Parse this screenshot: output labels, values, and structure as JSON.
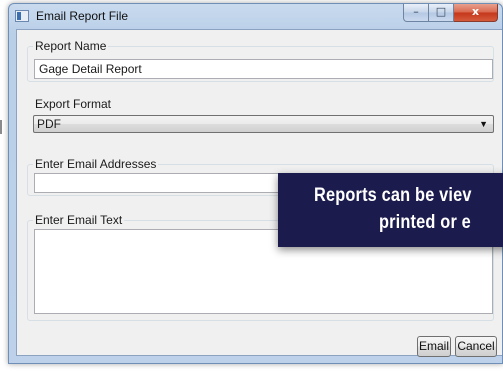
{
  "window": {
    "title": "Email Report File",
    "controls": {
      "minimize": "–",
      "maximize": "□",
      "close": "x"
    }
  },
  "form": {
    "report_name": {
      "label": "Report Name",
      "value": "Gage Detail Report"
    },
    "export_format": {
      "label": "Export Format",
      "selected": "PDF"
    },
    "email_addresses": {
      "label": "Enter Email Addresses",
      "value": ""
    },
    "email_text": {
      "label": "Enter Email Text",
      "value": ""
    }
  },
  "buttons": {
    "email": "Email",
    "cancel": "Cancel"
  },
  "overlay": {
    "line1": "Reports can be viev",
    "line2": "printed or e"
  }
}
